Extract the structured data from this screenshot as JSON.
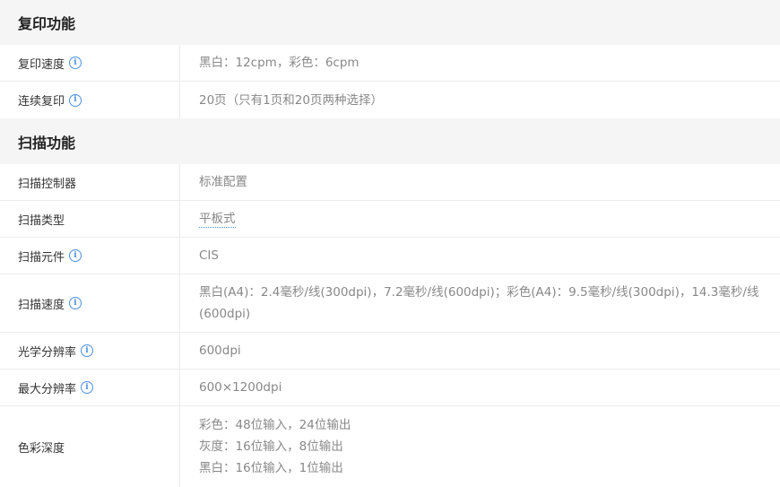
{
  "sections": {
    "copy": {
      "title": "复印功能",
      "rows": [
        {
          "label": "复印速度",
          "value": "黑白：12cpm，彩色：6cpm",
          "info": true
        },
        {
          "label": "连续复印",
          "value": "20页（只有1页和20页两种选择）",
          "info": true
        }
      ]
    },
    "scan": {
      "title": "扫描功能",
      "rows": [
        {
          "label": "扫描控制器",
          "value": "标准配置"
        },
        {
          "label": "扫描类型",
          "value": "平板式",
          "link": true
        },
        {
          "label": "扫描元件",
          "value": "CIS",
          "info": true
        },
        {
          "label": "扫描速度",
          "value_line1": "黑白(A4)：2.4毫秒/线(300dpi)，7.2毫秒/线(600dpi)；彩色(A4)：9.5毫秒/线(300dpi)，14.3毫秒/线",
          "value_line2": "(600dpi)",
          "info": true
        },
        {
          "label": "光学分辨率",
          "value": "600dpi",
          "info": true
        },
        {
          "label": "最大分辨率",
          "value": "600×1200dpi",
          "info": true
        },
        {
          "label": "色彩深度",
          "lines": [
            "彩色：48位输入，24位输出",
            "灰度：16位输入，8位输出",
            "黑白：16位输入，1位输出"
          ]
        }
      ]
    }
  },
  "icons": {
    "info": "info-icon"
  },
  "colors": {
    "accent": "#4a90e2",
    "header_bg": "#f5f5f5"
  }
}
